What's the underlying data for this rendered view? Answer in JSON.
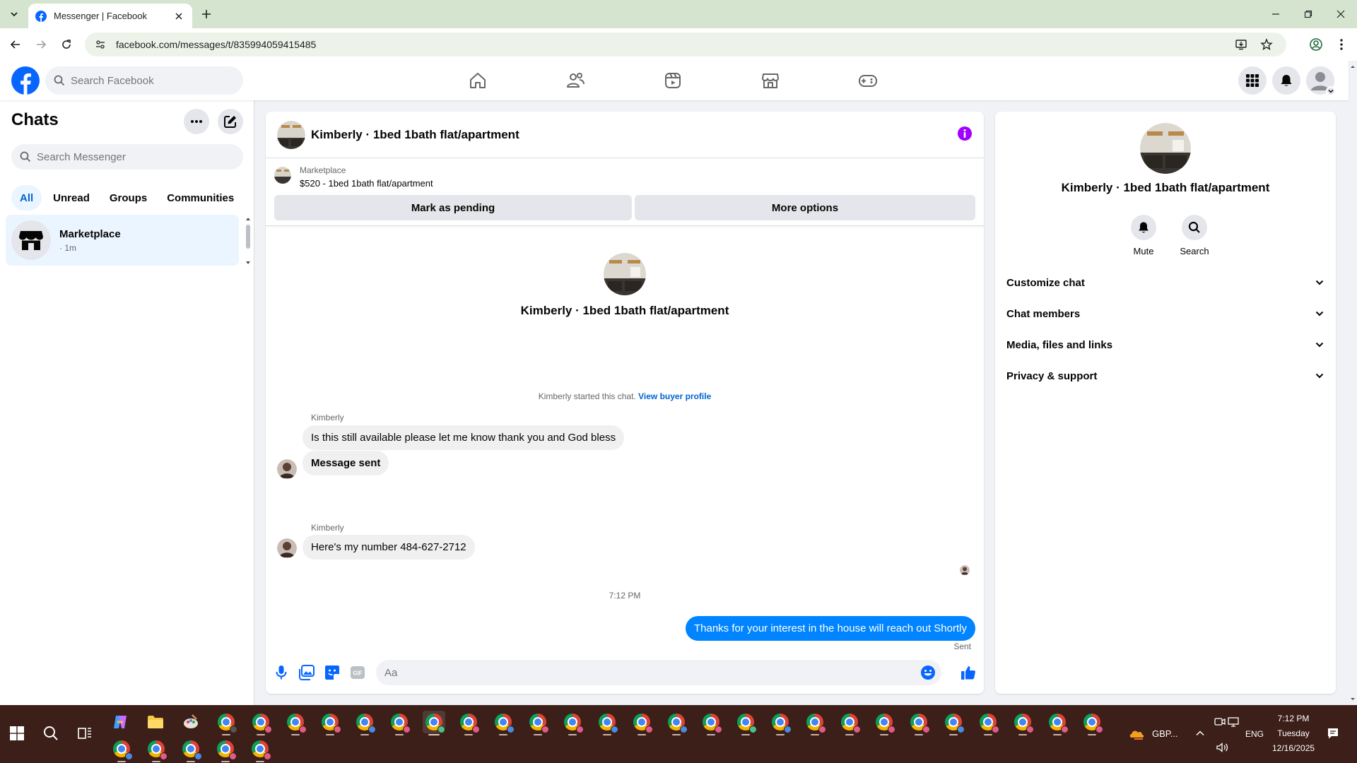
{
  "browser": {
    "tab_title": "Messenger | Facebook",
    "url": "facebook.com/messages/t/835994059415485"
  },
  "fb": {
    "search_placeholder": "Search Facebook",
    "brand_color": "#0866ff"
  },
  "sidebar": {
    "title": "Chats",
    "search_placeholder": "Search Messenger",
    "filters": [
      "All",
      "Unread",
      "Groups",
      "Communities"
    ],
    "active_filter": "All",
    "chats": [
      {
        "name": "Marketplace",
        "meta": "· 1m"
      }
    ]
  },
  "conversation": {
    "title": "Kimberly · 1bed 1bath flat/apartment",
    "marketplace": {
      "label": "Marketplace",
      "listing": "$520 - 1bed 1bath flat/apartment",
      "mark_pending": "Mark as pending",
      "more_options": "More options"
    },
    "hero_name": "Kimberly · 1bed 1bath flat/apartment",
    "started_text": "Kimberly started this chat.",
    "started_link": "View buyer profile",
    "messages": [
      {
        "sender": "Kimberly",
        "text": "Is this still available please let me know thank you and God bless"
      },
      {
        "text": "Message sent"
      },
      {
        "sender": "Kimberly",
        "text": "Here's my number  484-627-2712"
      }
    ],
    "timestamp": "7:12 PM",
    "outgoing": "Thanks for your interest in the house will reach out Shortly",
    "outgoing_status": "Sent",
    "composer_placeholder": "Aa",
    "bubble_color": "#0084ff"
  },
  "info": {
    "name": "Kimberly · 1bed 1bath flat/apartment",
    "actions": [
      "Mute",
      "Search"
    ],
    "sections": [
      "Customize chat",
      "Chat members",
      "Media, files and links",
      "Privacy & support"
    ]
  },
  "taskbar": {
    "weather": "GBP...",
    "lang": "ENG",
    "time": "7:12 PM",
    "day": "Tuesday",
    "date": "12/16/2025"
  }
}
